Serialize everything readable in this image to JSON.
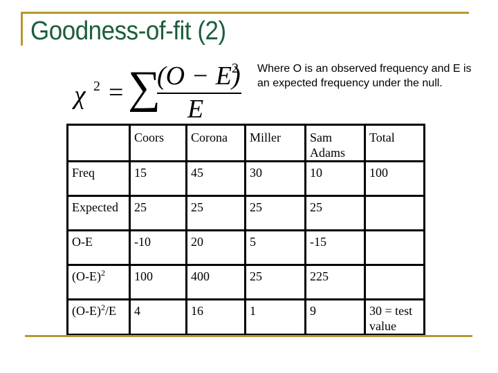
{
  "slide": {
    "title": "Goodness-of-fit (2)",
    "formula": {
      "lhs": "χ",
      "lhs_superscript": "2",
      "equals": "=",
      "sum_symbol": "∑",
      "numerator": "(O − E)",
      "numerator_superscript": "2",
      "denominator": "E"
    },
    "note": "Where O is an observed  frequency and E is an expected frequency under the null."
  },
  "table": {
    "header": [
      "",
      "Coors",
      "Corona",
      "Miller",
      "Sam Adams",
      "Total"
    ],
    "rows": [
      {
        "label": "Freq",
        "label_sup": "",
        "label_suffix": "",
        "cells": [
          "15",
          "45",
          "30",
          "10",
          "100"
        ]
      },
      {
        "label": "Expected",
        "label_sup": "",
        "label_suffix": "",
        "cells": [
          "25",
          "25",
          "25",
          "25",
          ""
        ]
      },
      {
        "label": "O-E",
        "label_sup": "",
        "label_suffix": "",
        "cells": [
          "-10",
          "20",
          "5",
          "-15",
          ""
        ]
      },
      {
        "label": "(O-E)",
        "label_sup": "2",
        "label_suffix": "",
        "cells": [
          "100",
          "400",
          "25",
          "225",
          ""
        ]
      },
      {
        "label": "(O-E)",
        "label_sup": "2",
        "label_suffix": "/E",
        "cells": [
          "4",
          "16",
          "1",
          "9",
          "30 = test value"
        ]
      }
    ]
  }
}
